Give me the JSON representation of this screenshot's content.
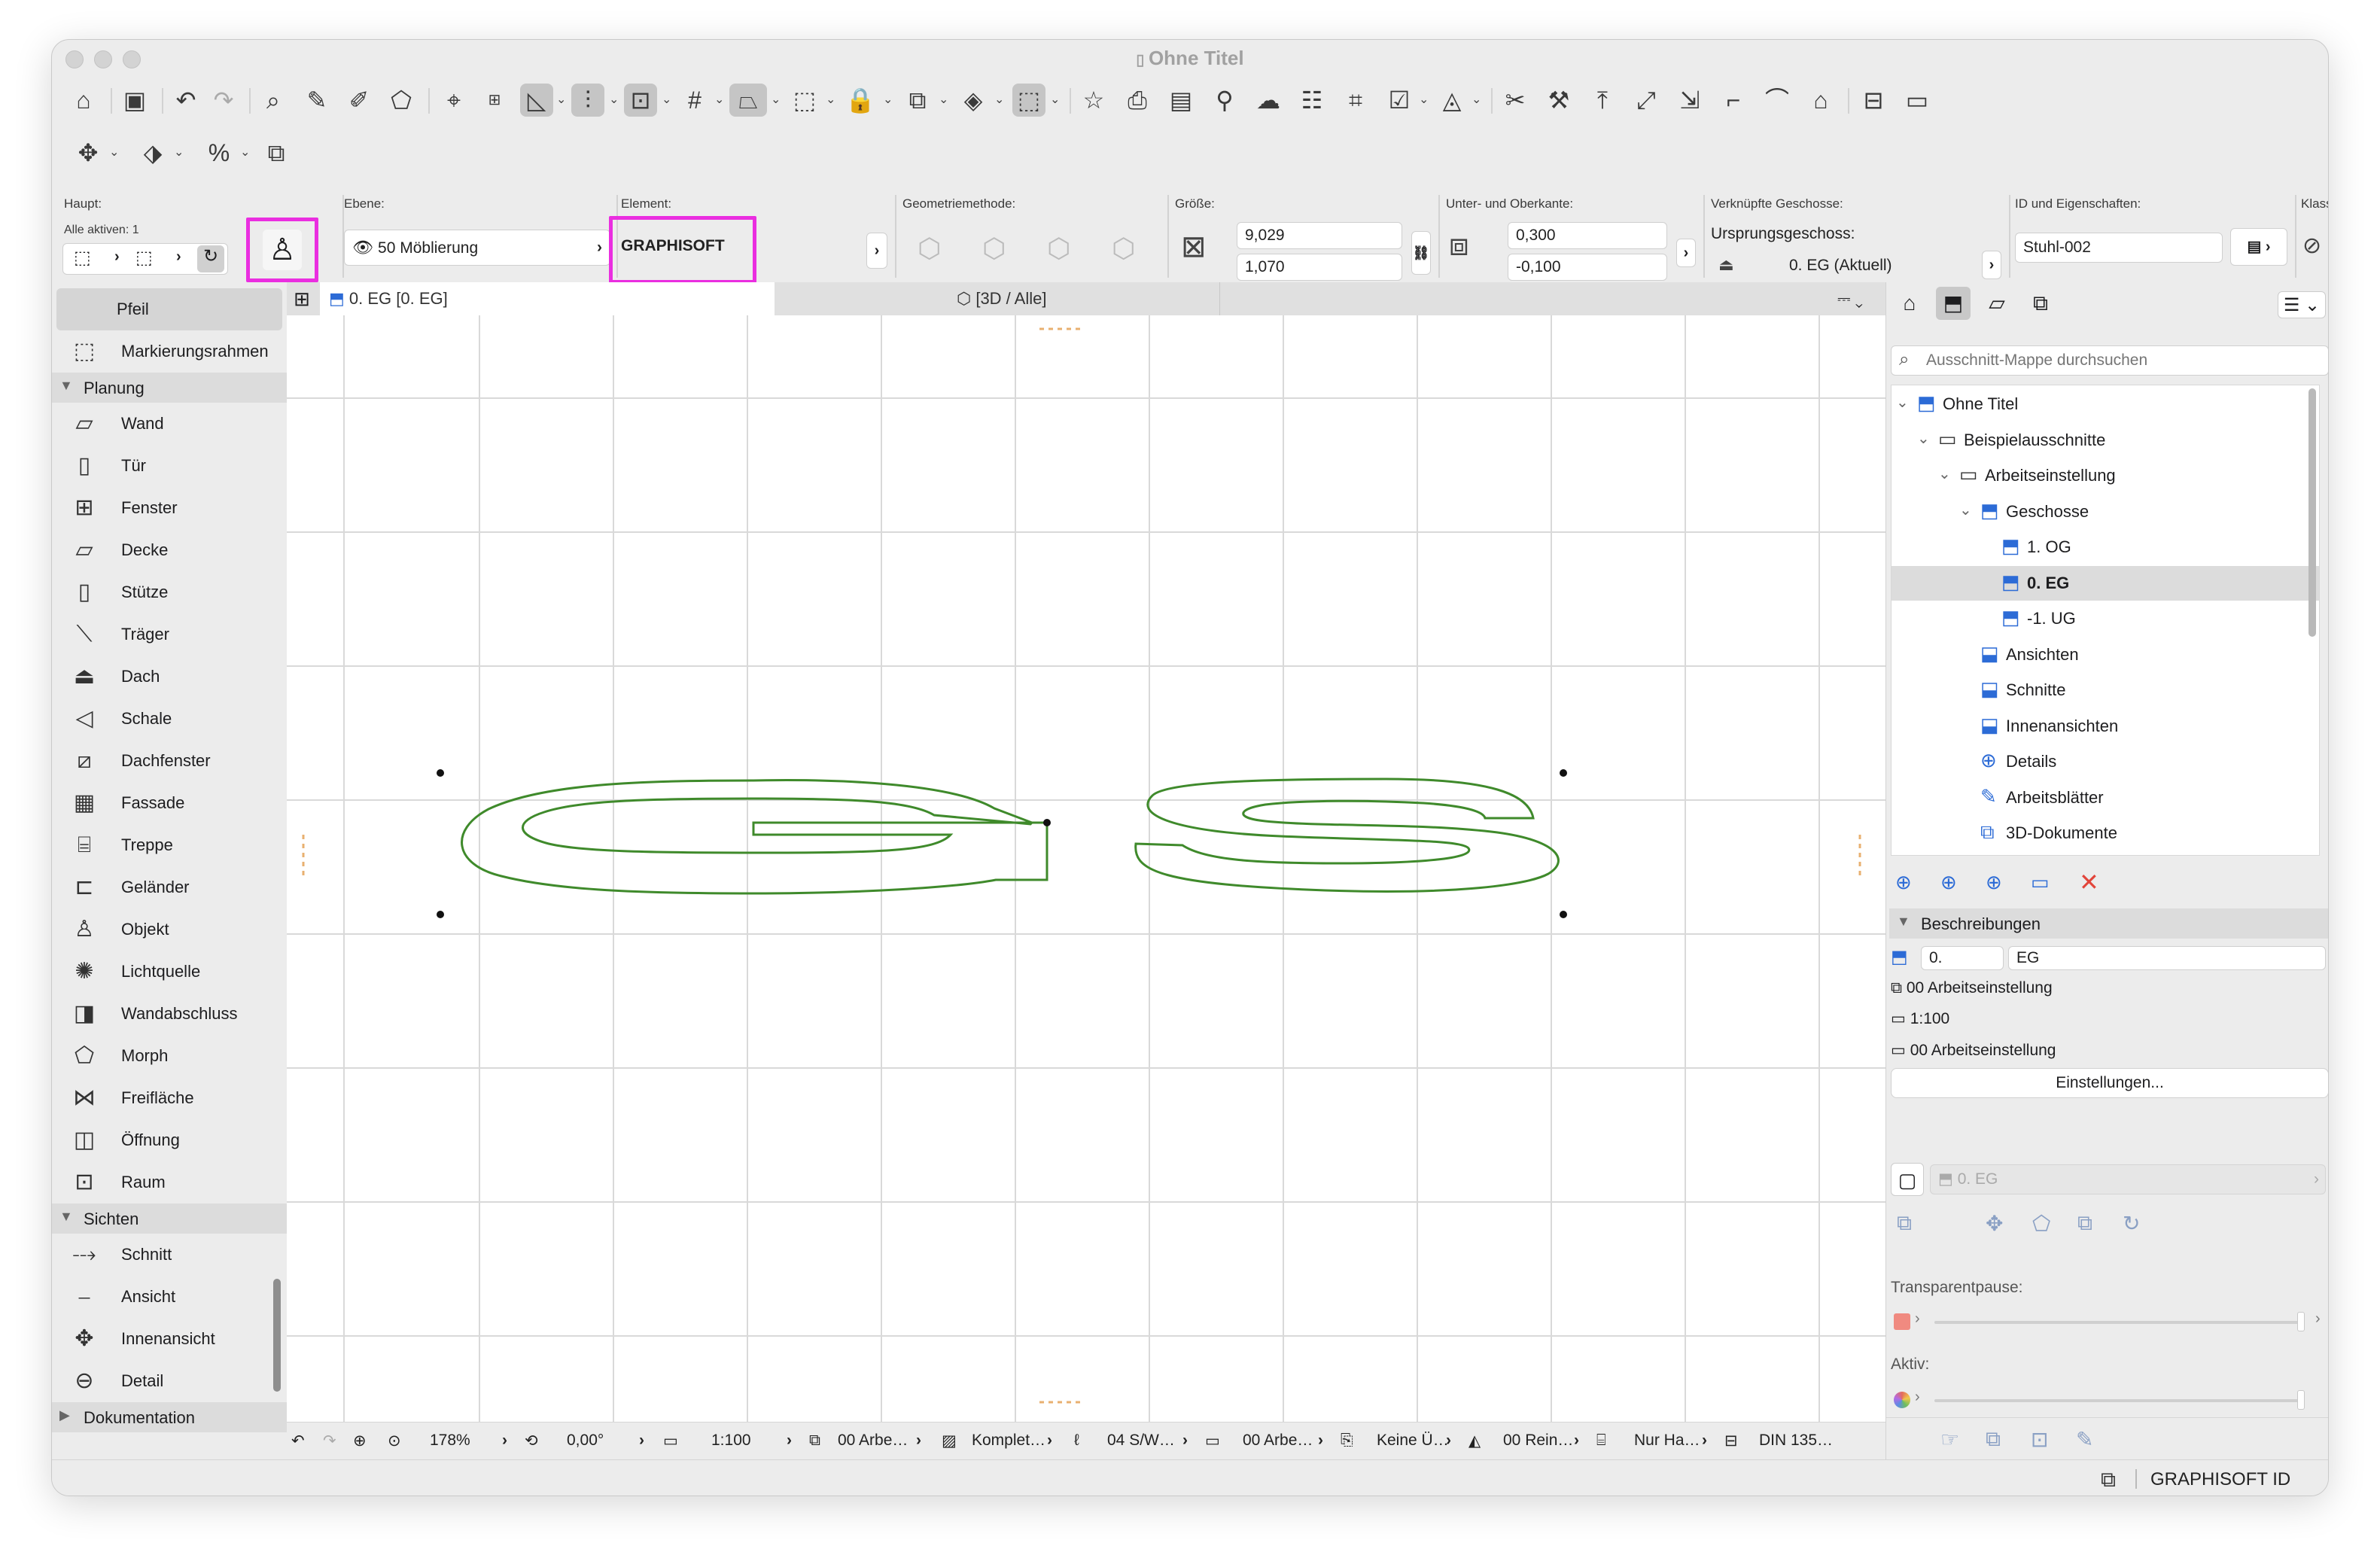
{
  "window": {
    "title": "Ohne Titel"
  },
  "info": {
    "haupt_label": "Haupt:",
    "alle_aktiven": "Alle aktiven: 1",
    "ebene_label": "Ebene:",
    "ebene_value": "50 Möblierung",
    "element_label": "Element:",
    "element_value": "GRAPHISOFT",
    "geometrie_label": "Geometriemethode:",
    "groesse_label": "Größe:",
    "width_value": "9,029",
    "height_value": "1,070",
    "kante_label": "Unter- und Oberkante:",
    "top_value": "0,300",
    "bottom_value": "-0,100",
    "geschosse_label": "Verknüpfte Geschosse:",
    "ursprung_label": "Ursprungsgeschoss:",
    "ursprung_value": "0. EG (Aktuell)",
    "id_label": "ID und Eigenschaften:",
    "id_value": "Stuhl-002",
    "klass_label": "Klass"
  },
  "toolbox": {
    "items_top": [
      {
        "label": "Pfeil",
        "icon": "arrow-pointer-icon"
      },
      {
        "label": "Markierungsrahmen",
        "icon": "marquee-icon"
      }
    ],
    "sections": [
      {
        "label": "Planung",
        "items": [
          {
            "label": "Wand",
            "icon": "wall-icon"
          },
          {
            "label": "Tür",
            "icon": "door-icon"
          },
          {
            "label": "Fenster",
            "icon": "window-icon"
          },
          {
            "label": "Decke",
            "icon": "slab-icon"
          },
          {
            "label": "Stütze",
            "icon": "column-icon"
          },
          {
            "label": "Träger",
            "icon": "beam-icon"
          },
          {
            "label": "Dach",
            "icon": "roof-icon"
          },
          {
            "label": "Schale",
            "icon": "shell-icon"
          },
          {
            "label": "Dachfenster",
            "icon": "skylight-icon"
          },
          {
            "label": "Fassade",
            "icon": "curtain-wall-icon"
          },
          {
            "label": "Treppe",
            "icon": "stair-icon"
          },
          {
            "label": "Geländer",
            "icon": "railing-icon"
          },
          {
            "label": "Objekt",
            "icon": "object-chair-icon"
          },
          {
            "label": "Lichtquelle",
            "icon": "lamp-icon"
          },
          {
            "label": "Wandabschluss",
            "icon": "wall-end-icon"
          },
          {
            "label": "Morph",
            "icon": "morph-icon"
          },
          {
            "label": "Freifläche",
            "icon": "mesh-icon"
          },
          {
            "label": "Öffnung",
            "icon": "opening-icon"
          },
          {
            "label": "Raum",
            "icon": "zone-icon"
          }
        ]
      },
      {
        "label": "Sichten",
        "items": [
          {
            "label": "Schnitt",
            "icon": "section-icon"
          },
          {
            "label": "Ansicht",
            "icon": "elevation-icon"
          },
          {
            "label": "Innenansicht",
            "icon": "interior-elevation-icon"
          },
          {
            "label": "Detail",
            "icon": "detail-icon"
          }
        ]
      },
      {
        "label": "Dokumentation",
        "items": []
      }
    ]
  },
  "tabs": [
    {
      "label": "0. EG [0. EG]",
      "icon": "floor-plan-icon"
    },
    {
      "label": "[3D / Alle]",
      "icon": "cube-3d-icon"
    }
  ],
  "canvas": {
    "text": "GS",
    "outline_color": "#3f8a2b"
  },
  "statusbar": {
    "zoom": "178%",
    "angle": "0,00°",
    "scale": "1:100",
    "layers": "00 Arbe…",
    "structure": "Komplet…",
    "pen_set": "04 S/W…",
    "model_view": "00 Arbe…",
    "override": "Keine Ü…",
    "renovation": "00 Rein…",
    "structure_display": "Nur Ha…",
    "dimension": "DIN 135…"
  },
  "navigator": {
    "search_placeholder": "Ausschnitt-Mappe durchsuchen",
    "tree": [
      {
        "label": "Ohne Titel",
        "level": 0,
        "twisty": "⌄",
        "icon": "project-icon"
      },
      {
        "label": "Beispielausschnitte",
        "level": 1,
        "twisty": "⌄",
        "icon": "folder-icon"
      },
      {
        "label": "Arbeitseinstellung",
        "level": 2,
        "twisty": "⌄",
        "icon": "folder-icon"
      },
      {
        "label": "Geschosse",
        "level": 3,
        "twisty": "⌄",
        "icon": "stories-icon"
      },
      {
        "label": "1. OG",
        "level": 4,
        "twisty": "",
        "icon": "story-icon"
      },
      {
        "label": "0. EG",
        "level": 4,
        "twisty": "",
        "icon": "story-icon",
        "selected": true
      },
      {
        "label": "-1. UG",
        "level": 4,
        "twisty": "",
        "icon": "story-icon"
      },
      {
        "label": "Ansichten",
        "level": 3,
        "twisty": "",
        "icon": "elevations-icon"
      },
      {
        "label": "Schnitte",
        "level": 3,
        "twisty": "",
        "icon": "sections-icon"
      },
      {
        "label": "Innenansichten",
        "level": 3,
        "twisty": "",
        "icon": "interior-elevations-icon"
      },
      {
        "label": "Details",
        "level": 3,
        "twisty": "",
        "icon": "details-icon"
      },
      {
        "label": "Arbeitsblätter",
        "level": 3,
        "twisty": "",
        "icon": "worksheets-icon"
      },
      {
        "label": "3D-Dokumente",
        "level": 3,
        "twisty": "",
        "icon": "3d-documents-icon"
      }
    ],
    "desc_header": "Beschreibungen",
    "view_number": "0.",
    "view_name": "EG",
    "layer_combo": "00 Arbeitseinstellung",
    "scale": "1:100",
    "model_view": "00 Arbeitseinstellung",
    "settings_button": "Einstellungen...",
    "current_view": "0. EG",
    "transparent_label": "Transparentpause:",
    "aktiv_label": "Aktiv:"
  },
  "brand": "GRAPHISOFT ID",
  "colors": {
    "highlight": "#ea2ee0",
    "outline": "#3f8a2b",
    "delete": "#e2453a",
    "folder_blue": "#2c6bd6"
  }
}
